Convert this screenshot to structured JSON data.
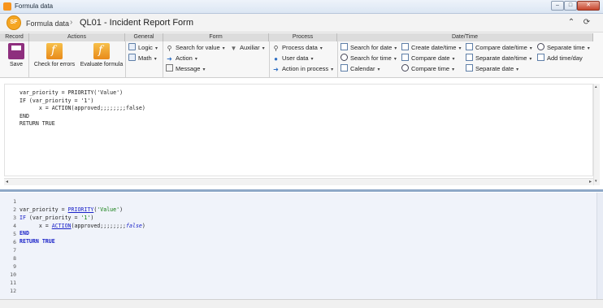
{
  "window": {
    "title": "Formula data",
    "min_label": "–",
    "max_label": "□",
    "close_label": "✕"
  },
  "header": {
    "logo_text": "SF",
    "breadcrumb": "Formula data",
    "separator": "›",
    "page_title": "QL01 - Incident Report Form",
    "collapse_icon": "⌃",
    "refresh_icon": "⟳"
  },
  "ribbon": {
    "groups": {
      "record": "Record",
      "actions": "Actions",
      "general": "General",
      "form": "Form",
      "process": "Process",
      "datetime": "Date/Time"
    },
    "record": {
      "save": "Save"
    },
    "actions": {
      "check_errors": "Check for errors",
      "evaluate": "Evaluate formula"
    },
    "general": {
      "logic": "Logic",
      "math": "Math"
    },
    "form": {
      "search_value": "Search for value",
      "auxiliar": "Auxiliar",
      "action": "Action",
      "message": "Message"
    },
    "process": {
      "process_data": "Process data",
      "user_data": "User data",
      "action_in_process": "Action in process"
    },
    "datetime": {
      "search_date": "Search for date",
      "search_time": "Search for time",
      "calendar": "Calendar",
      "create_datetime": "Create date/time",
      "compare_date": "Compare date",
      "compare_time": "Compare time",
      "compare_datetime": "Compare date/time",
      "separate_datetime": "Separate date/time",
      "separate_date": "Separate date",
      "separate_time": "Separate time",
      "add_timeday": "Add time/day"
    },
    "dropdown_arrow": "▾"
  },
  "editor": {
    "lines": [
      "var_priority = PRIORITY('Value')",
      "IF (var_priority = '1')",
      "      x = ACTION(approved;;;;;;;;false)",
      "END",
      "RETURN TRUE"
    ]
  },
  "preview": {
    "line_numbers": [
      "1",
      "2",
      "3",
      "4",
      "5",
      "6",
      "7",
      "8",
      "9",
      "10",
      "11",
      "12"
    ],
    "tokens": {
      "l2_var": "var_priority = ",
      "l2_fn": "PRIORITY",
      "l2_open": "(",
      "l2_str": "'Value'",
      "l2_close": ")",
      "l3_kw": "IF",
      "l3_rest": " (var_priority = ",
      "l3_str": "'1'",
      "l3_close": ")",
      "l4_pre": "      x = ",
      "l4_fn": "ACTION",
      "l4_args": "(approved;;;;;;;;",
      "l4_bool": "false",
      "l4_close": ")",
      "l5_kw": "END",
      "l6_kw": "RETURN",
      "l6_sp": " ",
      "l6_val": "TRUE"
    }
  },
  "scroll": {
    "left": "◂",
    "right": "▸",
    "up": "▴",
    "down": "▾"
  },
  "colors": {
    "accent": "#f5a623",
    "keyword": "#1a22c8",
    "string": "#0b7a0b",
    "ribbon_head": "#dcdcdc"
  }
}
